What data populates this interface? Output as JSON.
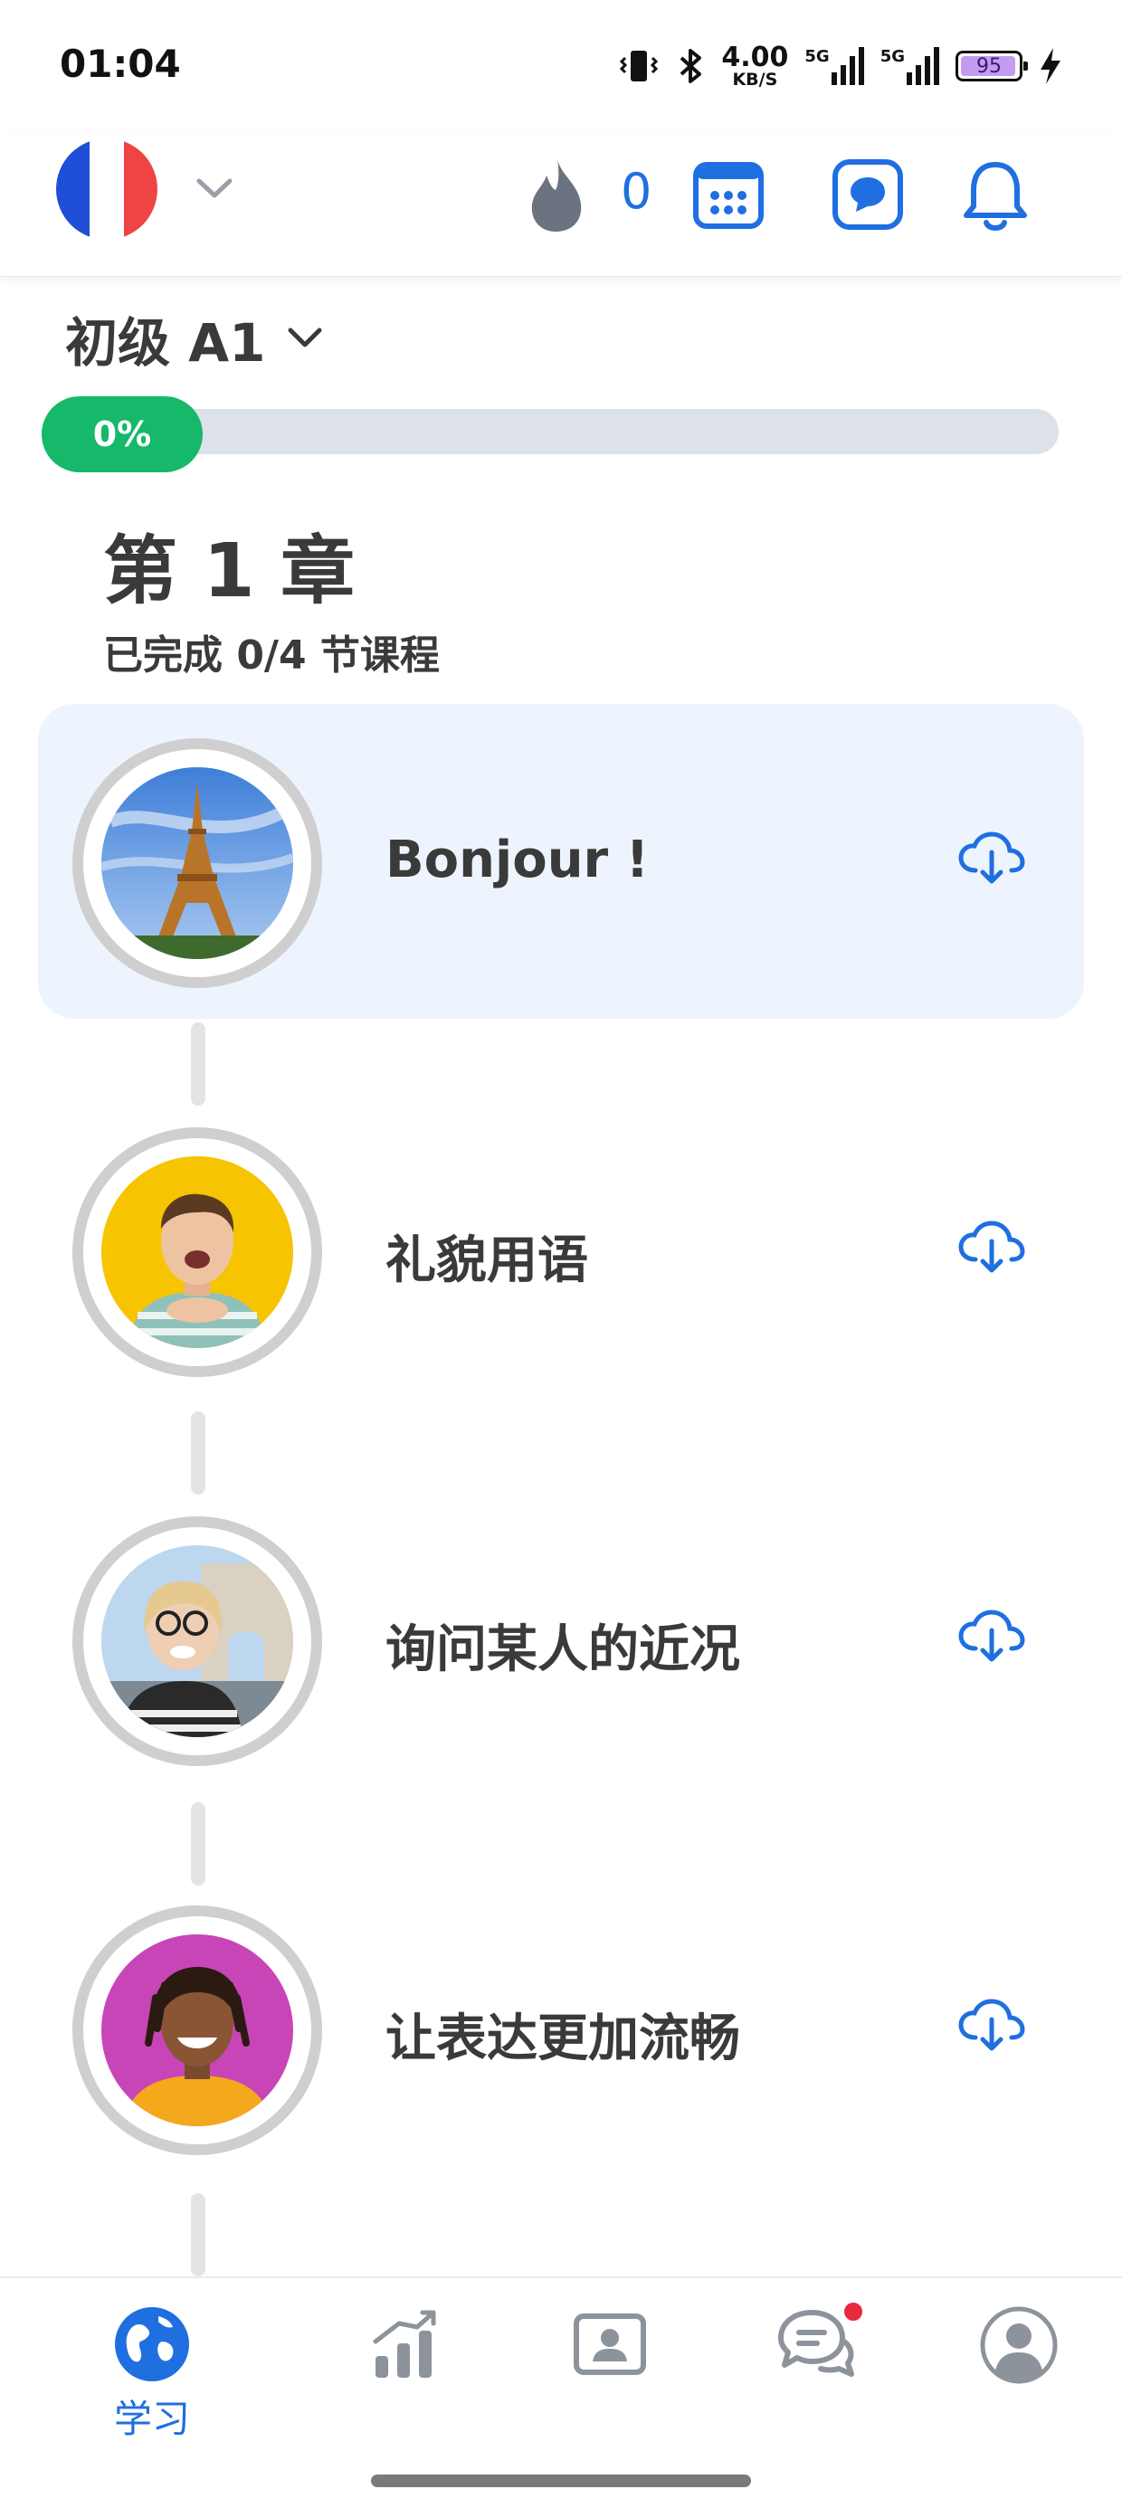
{
  "status_bar": {
    "time": "01:04",
    "net_speed": "4.00",
    "net_unit": "KB/S",
    "signal_1": "5G",
    "signal_2": "5G",
    "battery": "95"
  },
  "header": {
    "language_flag": "france-flag",
    "streak_count": "0",
    "icons": [
      "calendar-icon",
      "chat-bubble-icon",
      "bell-icon"
    ]
  },
  "level": {
    "title": "初级 A1",
    "progress_label": "0%",
    "progress": 0
  },
  "chapter": {
    "title": "第 1 章",
    "subtitle": "已完成 0/4 节课程"
  },
  "lessons": [
    {
      "name": "Bonjour !",
      "image": "eiffel-tower-photo",
      "active": true
    },
    {
      "name": "礼貌用语",
      "image": "smiling-man-photo",
      "active": false
    },
    {
      "name": "询问某人的近况",
      "image": "woman-arc-de-triomphe-photo",
      "active": false
    },
    {
      "name": "让表达更加流畅",
      "image": "man-dreadlocks-photo",
      "active": false
    }
  ],
  "bottom_nav": {
    "learn_label": "学习",
    "items": [
      "globe-icon",
      "progress-chart-icon",
      "tutor-icon",
      "community-chat-icon",
      "profile-icon"
    ]
  },
  "colors": {
    "accent_blue": "#1f6fe0",
    "progress_green": "#16b86a",
    "active_card_bg": "#eef4fd",
    "notification_red": "#e8283c"
  }
}
